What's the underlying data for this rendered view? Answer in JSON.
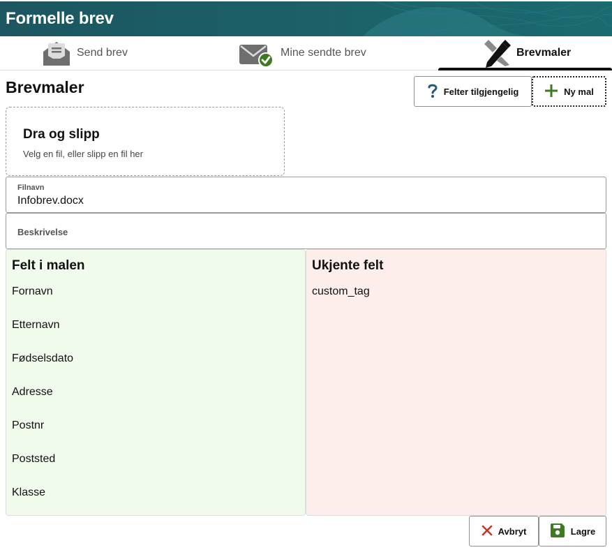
{
  "header": {
    "title": "Formelle brev"
  },
  "tabs": [
    {
      "label": "Send brev",
      "icon": "envelope-open-icon"
    },
    {
      "label": "Mine sendte brev",
      "icon": "envelope-check-icon"
    },
    {
      "label": "Brevmaler",
      "icon": "pencil-ruler-icon",
      "active": true
    }
  ],
  "page": {
    "title": "Brevmaler"
  },
  "toolbar": {
    "fields_label": "Felter tilgjengelig",
    "new_label": "Ny mal"
  },
  "dropzone": {
    "title": "Dra og slipp",
    "subtitle": "Velg en fil, eller slipp en fil her"
  },
  "form": {
    "filename_label": "Filnavn",
    "filename_value": "Infobrev.docx",
    "description_label": "Beskrivelse"
  },
  "known_fields": {
    "title": "Felt i malen",
    "items": [
      "Fornavn",
      "Etternavn",
      "Fødselsdato",
      "Adresse",
      "Postnr",
      "Poststed",
      "Klasse"
    ]
  },
  "unknown_fields": {
    "title": "Ukjente felt",
    "items": [
      "custom_tag"
    ]
  },
  "actions": {
    "cancel_label": "Avbryt",
    "save_label": "Lagre"
  },
  "colors": {
    "header_bg": "#1f5a64",
    "known_bg": "#f1fbec",
    "unknown_bg": "#fdeeec",
    "check_green": "#3d7a22",
    "cancel_red": "#c0392b",
    "question_blue": "#1f5a7a"
  }
}
